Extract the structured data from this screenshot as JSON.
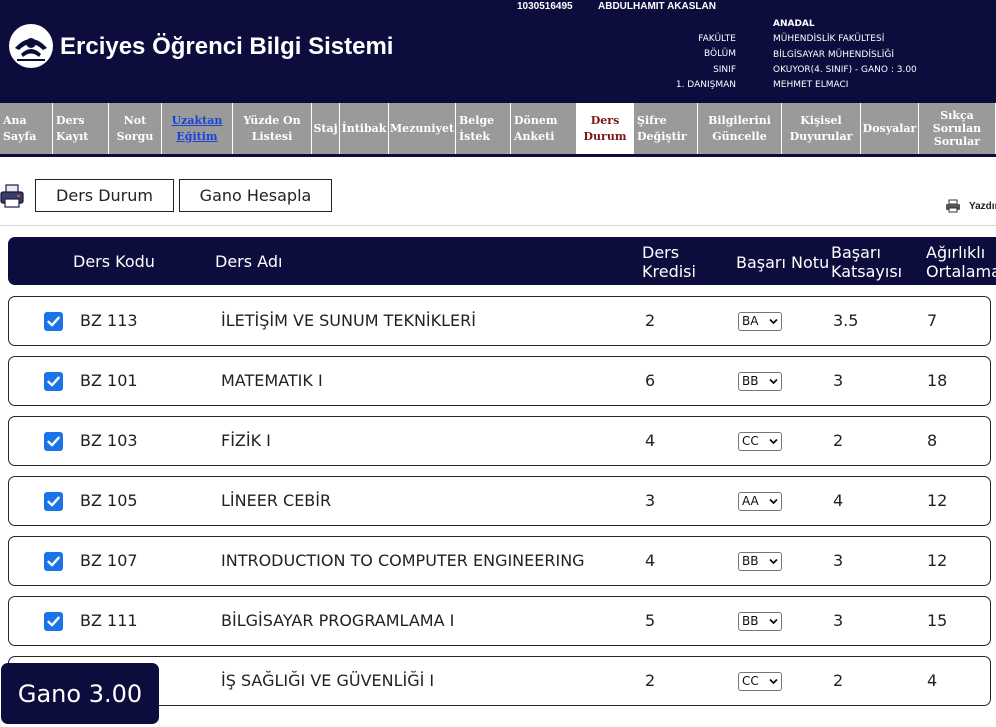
{
  "header": {
    "app_title": "Erciyes Öğrenci Bilgi Sistemi",
    "student_id": "1030516495",
    "student_name": "ABDULHAMIT AKASLAN",
    "labels": [
      "FAKÜLTE",
      "BÖLÜM",
      "SINIF",
      "1. DANIŞMAN"
    ],
    "program": "ANADAL",
    "faculty": "MÜHENDİSLİK FAKÜLTESİ",
    "department": "BİLGİSAYAR MÜHENDİSLİĞİ",
    "class_status": "OKUYOR(4. SINIF) - GANO : 3.00",
    "advisor": "MEHMET ELMACI",
    "colors": {
      "header_bg": "#0c0c3d",
      "nav_bg": "#9a9a9a",
      "active_tab_text": "#7a1616",
      "link": "#1a44d6",
      "checkbox": "#1a73e8"
    }
  },
  "nav": {
    "items": [
      {
        "line1": "Ana",
        "line2": "Sayfa",
        "line3": ""
      },
      {
        "line1": "Ders",
        "line2": "Kayıt",
        "line3": ""
      },
      {
        "line1": "Not",
        "line2": "Sorgu",
        "line3": ""
      },
      {
        "line1": "Uzaktan",
        "line2": "Eğitim",
        "line3": ""
      },
      {
        "line1": "Yüzde On",
        "line2": "Listesi",
        "line3": ""
      },
      {
        "line1": "Staj",
        "line2": "",
        "line3": ""
      },
      {
        "line1": "İntibak",
        "line2": "",
        "line3": ""
      },
      {
        "line1": "Mezuniyet",
        "line2": "",
        "line3": ""
      },
      {
        "line1": "Belge",
        "line2": "İstek",
        "line3": ""
      },
      {
        "line1": "Dönem",
        "line2": "Anketi",
        "line3": ""
      },
      {
        "line1": "Ders",
        "line2": "Durum",
        "line3": ""
      },
      {
        "line1": "Şifre",
        "line2": "Değiştir",
        "line3": ""
      },
      {
        "line1": "Bilgilerini",
        "line2": "Güncelle",
        "line3": ""
      },
      {
        "line1": "Kişisel",
        "line2": "Duyurular",
        "line3": ""
      },
      {
        "line1": "Dosyalar",
        "line2": "",
        "line3": ""
      },
      {
        "line1": "Sıkça",
        "line2": "Sorulan",
        "line3": "Sorular"
      }
    ],
    "active": "Ders Durum"
  },
  "toolbar": {
    "ders_durum_label": "Ders Durum",
    "gano_hesapla_label": "Gano Hesapla",
    "print_label": "Yazdır"
  },
  "table": {
    "headers": {
      "kod": "Ders Kodu",
      "ad": "Ders Adı",
      "kredi_1": "Ders",
      "kredi_2": "Kredisi",
      "notu": "Başarı Notu",
      "katsayi_1": "Başarı",
      "katsayi_2": "Katsayısı",
      "ortalama_1": "Ağırlıklı",
      "ortalama_2": "Ortalama"
    },
    "rows": [
      {
        "checked": true,
        "kod": "BZ 113",
        "ad": "İLETİŞİM VE SUNUM TEKNİKLERİ",
        "kredi": "2",
        "notu": "BA",
        "katsayi": "3.5",
        "ortalama": "7"
      },
      {
        "checked": true,
        "kod": "BZ 101",
        "ad": "MATEMATIK I",
        "kredi": "6",
        "notu": "BB",
        "katsayi": "3",
        "ortalama": "18"
      },
      {
        "checked": true,
        "kod": "BZ 103",
        "ad": "FİZİK I",
        "kredi": "4",
        "notu": "CC",
        "katsayi": "2",
        "ortalama": "8"
      },
      {
        "checked": true,
        "kod": "BZ 105",
        "ad": "LİNEER CEBİR",
        "kredi": "3",
        "notu": "AA",
        "katsayi": "4",
        "ortalama": "12"
      },
      {
        "checked": true,
        "kod": "BZ 107",
        "ad": "INTRODUCTION TO COMPUTER ENGINEERING",
        "kredi": "4",
        "notu": "BB",
        "katsayi": "3",
        "ortalama": "12"
      },
      {
        "checked": true,
        "kod": "BZ 111",
        "ad": "BİLGİSAYAR PROGRAMLAMA I",
        "kredi": "5",
        "notu": "BB",
        "katsayi": "3",
        "ortalama": "15"
      },
      {
        "checked": true,
        "kod": "",
        "ad": "İŞ SAĞLIĞI VE GÜVENLİĞİ I",
        "kredi": "2",
        "notu": "CC",
        "katsayi": "2",
        "ortalama": "4"
      }
    ]
  },
  "gano": {
    "label": "Gano 3.00"
  }
}
